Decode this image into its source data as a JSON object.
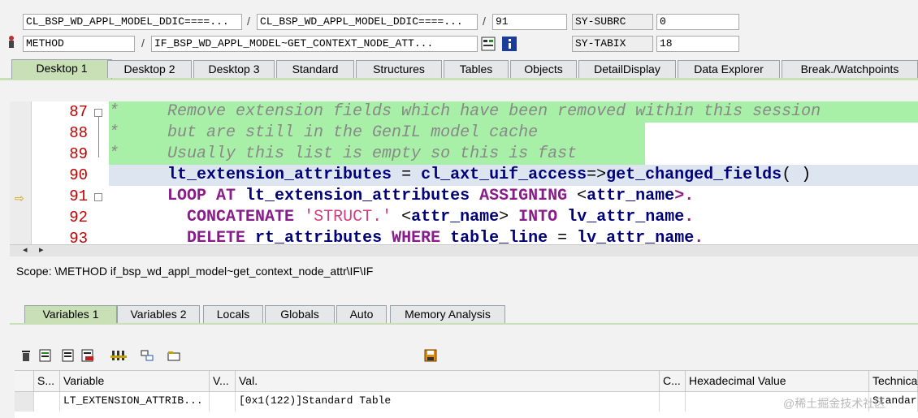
{
  "header": {
    "program": "CL_BSP_WD_APPL_MODEL_DDIC====...",
    "include": "CL_BSP_WD_APPL_MODEL_DDIC====...",
    "line": "91",
    "event_type": "METHOD",
    "event": "IF_BSP_WD_APPL_MODEL~GET_CONTEXT_NODE_ATT...",
    "sys_field_1": "SY-SUBRC",
    "sys_value_1": "0",
    "sys_field_2": "SY-TABIX",
    "sys_value_2": "18",
    "separator": "/"
  },
  "desktop_tabs": [
    "Desktop 1",
    "Desktop 2",
    "Desktop 3",
    "Standard",
    "Structures",
    "Tables",
    "Objects",
    "DetailDisplay",
    "Data Explorer",
    "Break./Watchpoints"
  ],
  "code": {
    "lines": [
      {
        "num": "87",
        "parts": [
          {
            "t": "*     Remove extension fields which have been removed within this session",
            "c": ""
          }
        ]
      },
      {
        "num": "88",
        "parts": [
          {
            "t": "*     but are still in the GenIL model cache",
            "c": ""
          }
        ]
      },
      {
        "num": "89",
        "parts": [
          {
            "t": "*     Usually this list is empty so this is fast",
            "c": ""
          }
        ]
      },
      {
        "num": "90",
        "parts": [
          {
            "t": "      ",
            "c": ""
          },
          {
            "t": "lt_extension_attributes",
            "c": "idn"
          },
          {
            "t": " = ",
            "c": ""
          },
          {
            "t": "cl_axt_uif_access",
            "c": "idn"
          },
          {
            "t": "=>",
            "c": ""
          },
          {
            "t": "get_changed_fields",
            "c": "idn"
          },
          {
            "t": "( )",
            "c": ""
          }
        ]
      },
      {
        "num": "91",
        "parts": [
          {
            "t": "      ",
            "c": ""
          },
          {
            "t": "LOOP AT",
            "c": "kw"
          },
          {
            "t": " ",
            "c": ""
          },
          {
            "t": "lt_extension_attributes",
            "c": "idn"
          },
          {
            "t": " ",
            "c": ""
          },
          {
            "t": "ASSIGNING",
            "c": "kw"
          },
          {
            "t": " <",
            "c": ""
          },
          {
            "t": "attr_name",
            "c": "idn"
          },
          {
            "t": ">.",
            "c": "kw"
          }
        ]
      },
      {
        "num": "92",
        "parts": [
          {
            "t": "        ",
            "c": ""
          },
          {
            "t": "CONCATENATE",
            "c": "kw"
          },
          {
            "t": " ",
            "c": ""
          },
          {
            "t": "'STRUCT.'",
            "c": "str"
          },
          {
            "t": " <",
            "c": ""
          },
          {
            "t": "attr_name",
            "c": "idn"
          },
          {
            "t": "> ",
            "c": ""
          },
          {
            "t": "INTO",
            "c": "kw"
          },
          {
            "t": " ",
            "c": ""
          },
          {
            "t": "lv_attr_name",
            "c": "idn"
          },
          {
            "t": ".",
            "c": "kw"
          }
        ]
      },
      {
        "num": "93",
        "parts": [
          {
            "t": "        ",
            "c": ""
          },
          {
            "t": "DELETE",
            "c": "kw"
          },
          {
            "t": " ",
            "c": ""
          },
          {
            "t": "rt_attributes",
            "c": "idn"
          },
          {
            "t": " ",
            "c": ""
          },
          {
            "t": "WHERE",
            "c": "kw"
          },
          {
            "t": " ",
            "c": ""
          },
          {
            "t": "table_line",
            "c": "idn"
          },
          {
            "t": " = ",
            "c": ""
          },
          {
            "t": "lv_attr_name",
            "c": "idn"
          },
          {
            "t": ".",
            "c": "kw"
          }
        ]
      }
    ]
  },
  "scope": "Scope: \\METHOD if_bsp_wd_appl_model~get_context_node_attr\\IF\\IF",
  "var_tabs": [
    "Variables 1",
    "Variables 2",
    "Locals",
    "Globals",
    "Auto",
    "Memory Analysis"
  ],
  "table": {
    "headers": [
      "S...",
      "Variable",
      "V...",
      "Val.",
      "C...",
      "Hexadecimal Value",
      "Technica"
    ],
    "row": {
      "variable": "LT_EXTENSION_ATTRIB...",
      "value": "[0x1(122)]Standard Table",
      "technical": "Standard"
    }
  },
  "watermark": "@稀土掘金技术社区",
  "colors": {
    "active_tab": "#c9dfb6",
    "comment_bg": "#a8f0a8",
    "line_number": "#c00000",
    "keyword": "#8a1b8a"
  }
}
